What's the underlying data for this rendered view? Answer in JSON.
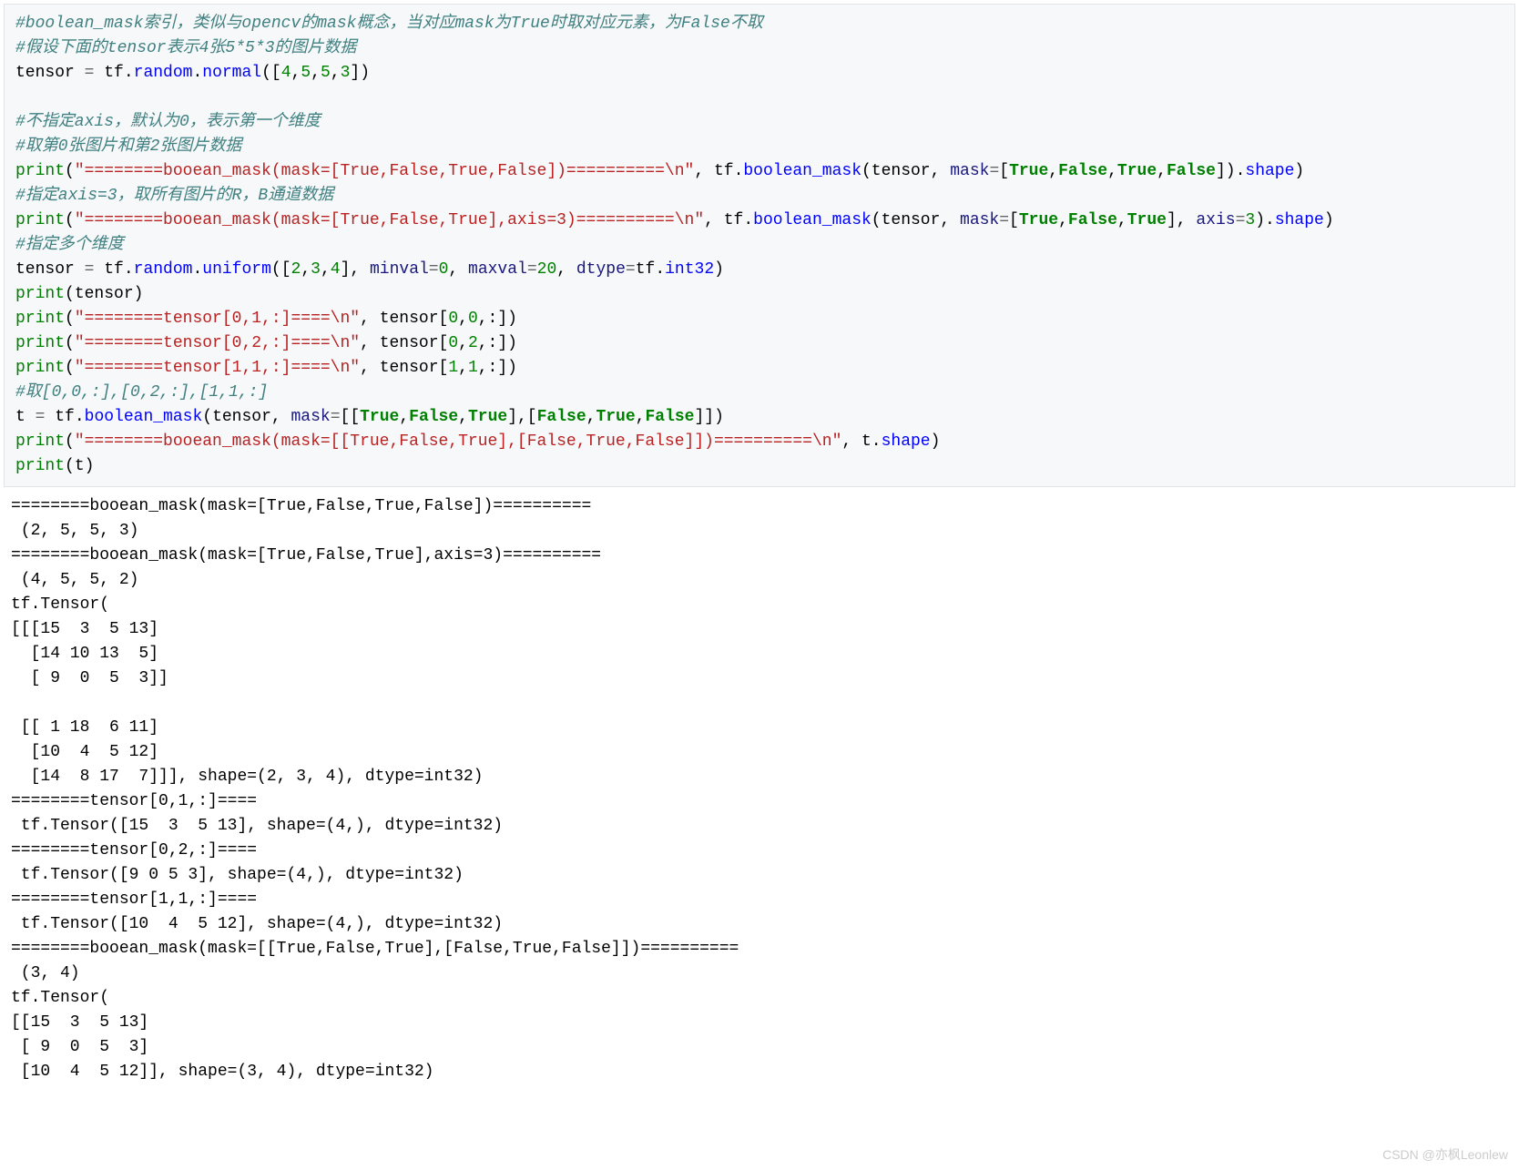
{
  "code": {
    "c1": "#boolean_mask索引，类似与opencv的mask概念，当对应mask为True时取对应元素，为False不取",
    "c2": "#假设下面的tensor表示4张5*5*3的图片数据",
    "l3_a": "tensor ",
    "l3_b": " tf",
    "l3_c": "random",
    "l3_d": "normal",
    "l3_e": "([",
    "l3_f": "4",
    "l3_g": "5",
    "l3_h": "5",
    "l3_i": "3",
    "l3_j": "])",
    "c4": "#不指定axis，默认为0，表示第一个维度",
    "c5": "#取第0张图片和第2张图片数据",
    "l6_print": "print",
    "l6_s1": "\"========booean_mask(mask=[True,False,True,False])==========\\n\"",
    "l6_bm": "boolean_mask",
    "l6_mask": "mask",
    "l6_t": "True",
    "l6_f": "False",
    "l6_shape": "shape",
    "c7": "#指定axis=3，取所有图片的R，B通道数据",
    "l8_s1": "\"========booean_mask(mask=[True,False,True],axis=3)==========\\n\"",
    "l8_axis": "axis",
    "l8_n3": "3",
    "c9": "#指定多个维度",
    "l10_uni": "uniform",
    "l10_dims": "2,3,4",
    "l10_n2": "2",
    "l10_n3": "3",
    "l10_n4": "4",
    "l10_minval": "minval",
    "l10_maxval": "maxval",
    "l10_n0": "0",
    "l10_n20": "20",
    "l10_dtype": "dtype",
    "l10_int32": "int32",
    "l11_s": "\"========tensor[0,1,:]====\\n\"",
    "l11_idx": "0,0,:",
    "l12_s": "\"========tensor[0,2,:]====\\n\"",
    "l12_idx": "0,2,:",
    "l13_s": "\"========tensor[1,1,:]====\\n\"",
    "l13_idx": "1,1,:",
    "c14": "#取[0,0,:],[0,2,:],[1,1,:]",
    "l15_t": "t ",
    "l16_s": "\"========booean_mask(mask=[[True,False,True],[False,True,False]])==========\\n\"",
    "tensor": "tensor",
    "tf": "tf",
    "dot": ".",
    "eq": "=",
    "comma": ",",
    "lb": "[",
    "rb": "]",
    "lp": "(",
    "rp": ")"
  },
  "output": {
    "o1": "========booean_mask(mask=[True,False,True,False])==========",
    "o2": " (2, 5, 5, 3)",
    "o3": "========booean_mask(mask=[True,False,True],axis=3)==========",
    "o4": " (4, 5, 5, 2)",
    "o5": "tf.Tensor(",
    "o6": "[[[15  3  5 13]",
    "o7": "  [14 10 13  5]",
    "o8": "  [ 9  0  5  3]]",
    "o9": "",
    "o10": " [[ 1 18  6 11]",
    "o11": "  [10  4  5 12]",
    "o12": "  [14  8 17  7]]], shape=(2, 3, 4), dtype=int32)",
    "o13": "========tensor[0,1,:]====",
    "o14": " tf.Tensor([15  3  5 13], shape=(4,), dtype=int32)",
    "o15": "========tensor[0,2,:]====",
    "o16": " tf.Tensor([9 0 5 3], shape=(4,), dtype=int32)",
    "o17": "========tensor[1,1,:]====",
    "o18": " tf.Tensor([10  4  5 12], shape=(4,), dtype=int32)",
    "o19": "========booean_mask(mask=[[True,False,True],[False,True,False]])==========",
    "o20": " (3, 4)",
    "o21": "tf.Tensor(",
    "o22": "[[15  3  5 13]",
    "o23": " [ 9  0  5  3]",
    "o24": " [10  4  5 12]], shape=(3, 4), dtype=int32)"
  },
  "watermark": "CSDN @亦枫Leonlew"
}
